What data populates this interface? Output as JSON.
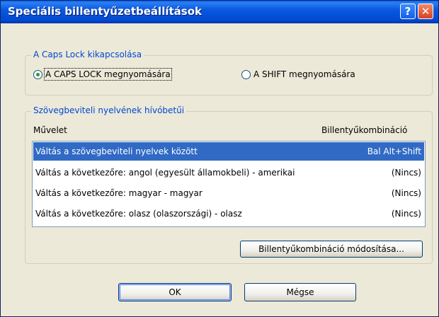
{
  "window": {
    "title": "Speciális billentyűzetbeállítások",
    "help_label": "?",
    "close_label": "✕"
  },
  "caps_group": {
    "legend": "A Caps Lock kikapcsolása",
    "option_caps": "A CAPS LOCK megnyomására",
    "option_shift": "A SHIFT megnyomására",
    "selected": "caps"
  },
  "hotkeys_group": {
    "legend": "Szövegbeviteli nyelvének hívóbetűi",
    "col_action": "Művelet",
    "col_hotkey": "Billentyűkombináció",
    "rows": [
      {
        "action": "Váltás a szövegbeviteli nyelvek között",
        "hotkey": "Bal Alt+Shift",
        "selected": true
      },
      {
        "action": "Váltás a következőre: angol (egyesült államokbeli) - amerikai",
        "hotkey": "(Nincs)"
      },
      {
        "action": "Váltás a következőre: magyar - magyar",
        "hotkey": "(Nincs)"
      },
      {
        "action": "Váltás a következőre: olasz (olaszországi) - olasz",
        "hotkey": "(Nincs)"
      }
    ],
    "change_button": "Billentyűkombináció módosítása..."
  },
  "buttons": {
    "ok": "OK",
    "cancel": "Mégse"
  }
}
